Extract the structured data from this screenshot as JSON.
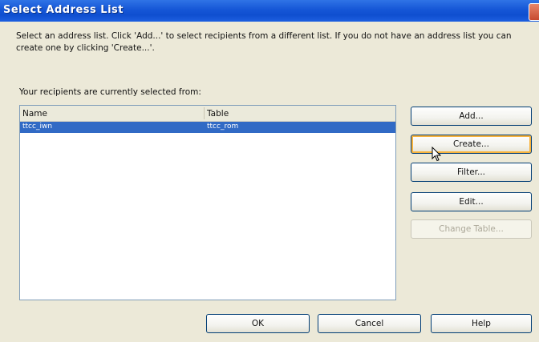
{
  "window": {
    "title": "Select Address List"
  },
  "instructions": "Select an address list. Click 'Add...' to select recipients from a different list. If you do not have an address list you can create one by clicking 'Create...'.",
  "selected_from_label": "Your recipients are currently selected from:",
  "list": {
    "columns": [
      "Name",
      "Table"
    ],
    "rows": [
      {
        "name": "ttcc_iwn",
        "table": "ttcc_rom"
      }
    ]
  },
  "buttons": {
    "add": "Add...",
    "create": "Create...",
    "filter": "Filter...",
    "edit": "Edit...",
    "change_table": "Change Table...",
    "ok": "OK",
    "cancel": "Cancel",
    "help": "Help"
  },
  "icons": {
    "close": "close-icon",
    "cursor": "mouse-cursor-icon"
  }
}
